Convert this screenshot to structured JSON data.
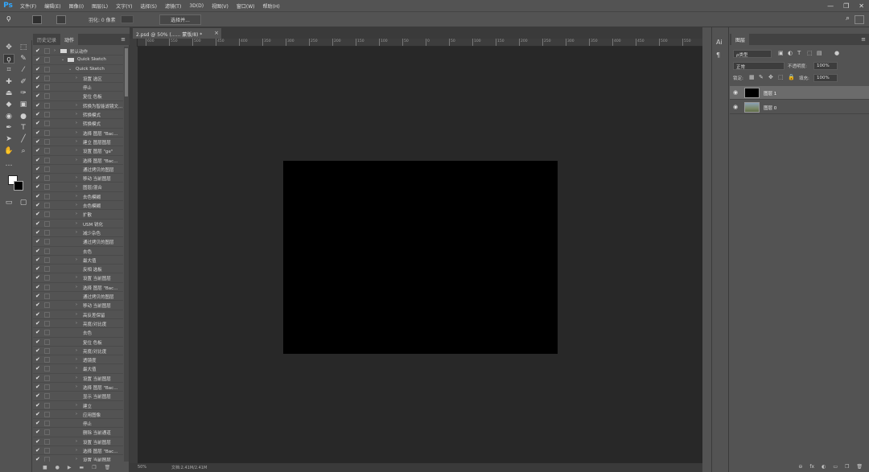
{
  "app": {
    "logo": "Ps"
  },
  "menu": [
    "文件(F)",
    "编辑(E)",
    "图像(I)",
    "图层(L)",
    "文字(Y)",
    "选择(S)",
    "滤镜(T)",
    "3D(D)",
    "视图(V)",
    "窗口(W)",
    "帮助(H)"
  ],
  "window_controls": [
    "—",
    "❐",
    "✕"
  ],
  "options": {
    "feather_label": "羽化: 0 像素",
    "select_mask_label": "选择并..."
  },
  "actions_panel": {
    "tabs": [
      "历史记录",
      "动作"
    ],
    "rows": [
      {
        "label": "默认动作",
        "indent": 0,
        "folder": true,
        "expand": "›"
      },
      {
        "label": "Quick Sketch",
        "indent": 1,
        "folder": true,
        "expand": "⌄"
      },
      {
        "label": "Quick Sketch",
        "indent": 2,
        "folder": false,
        "expand": "⌄"
      },
      {
        "label": "设置 选区",
        "indent": 3,
        "expand": "›"
      },
      {
        "label": "停止",
        "indent": 3,
        "expand": ""
      },
      {
        "label": "复位 色板",
        "indent": 3,
        "expand": ""
      },
      {
        "label": "转换为智能滤镜文...",
        "indent": 3,
        "expand": "›"
      },
      {
        "label": "转换模式",
        "indent": 3,
        "expand": "›"
      },
      {
        "label": "转换模式",
        "indent": 3,
        "expand": "›"
      },
      {
        "label": "选择 图层 \"Bac...",
        "indent": 3,
        "expand": "›"
      },
      {
        "label": "建立 图层图层",
        "indent": 3,
        "expand": "›"
      },
      {
        "label": "设置 图层 \"ge\"",
        "indent": 3,
        "expand": "›"
      },
      {
        "label": "选择 图层 \"Bac...",
        "indent": 3,
        "expand": "›"
      },
      {
        "label": "通过拷贝的图层",
        "indent": 3,
        "expand": ""
      },
      {
        "label": "移动 当前图层",
        "indent": 3,
        "expand": "›"
      },
      {
        "label": "图层/混合",
        "indent": 3,
        "expand": "›"
      },
      {
        "label": "去色模糊",
        "indent": 3,
        "expand": "›"
      },
      {
        "label": "去色模糊",
        "indent": 3,
        "expand": "›"
      },
      {
        "label": "扩散",
        "indent": 3,
        "expand": "›"
      },
      {
        "label": "USM 锐化",
        "indent": 3,
        "expand": "›"
      },
      {
        "label": "减少杂色",
        "indent": 3,
        "expand": "›"
      },
      {
        "label": "通过拷贝的图层",
        "indent": 3,
        "expand": ""
      },
      {
        "label": "去色",
        "indent": 3,
        "expand": ""
      },
      {
        "label": "最大值",
        "indent": 3,
        "expand": "›"
      },
      {
        "label": "反相 选板",
        "indent": 3,
        "expand": ""
      },
      {
        "label": "设置 当前图层",
        "indent": 3,
        "expand": "›"
      },
      {
        "label": "选择 图层 \"Bac...",
        "indent": 3,
        "expand": "›"
      },
      {
        "label": "通过拷贝的图层",
        "indent": 3,
        "expand": ""
      },
      {
        "label": "移动 当前图层",
        "indent": 3,
        "expand": "›"
      },
      {
        "label": "高反差保留",
        "indent": 3,
        "expand": "›"
      },
      {
        "label": "亮度/对比度",
        "indent": 3,
        "expand": "›"
      },
      {
        "label": "去色",
        "indent": 3,
        "expand": ""
      },
      {
        "label": "复位 色板",
        "indent": 3,
        "expand": ""
      },
      {
        "label": "亮度/对比度",
        "indent": 3,
        "expand": "›"
      },
      {
        "label": "透镜度",
        "indent": 3,
        "expand": "›"
      },
      {
        "label": "最大值",
        "indent": 3,
        "expand": "›"
      },
      {
        "label": "设置 当前图层",
        "indent": 3,
        "expand": "›"
      },
      {
        "label": "选择 图层 \"Bac...",
        "indent": 3,
        "expand": "›"
      },
      {
        "label": "显示 当前图层",
        "indent": 3,
        "expand": ""
      },
      {
        "label": "建立",
        "indent": 3,
        "expand": "›"
      },
      {
        "label": "应用图像",
        "indent": 3,
        "expand": "›"
      },
      {
        "label": "停止",
        "indent": 3,
        "expand": ""
      },
      {
        "label": "删除 当前通道",
        "indent": 3,
        "expand": ""
      },
      {
        "label": "设置 当前图层",
        "indent": 3,
        "expand": "›"
      },
      {
        "label": "选择 图层 \"Bac...",
        "indent": 3,
        "expand": "›"
      },
      {
        "label": "设置 当前图层",
        "indent": 3,
        "expand": "›"
      }
    ],
    "footer_icons": [
      "■",
      "●",
      "▶",
      "▬",
      "❐",
      "🗑"
    ]
  },
  "document": {
    "tab_label": "2.psd @ 50% (...... 蒙版/8) *",
    "close_glyph": "×",
    "ruler_labels": [
      "600",
      "550",
      "500",
      "450",
      "400",
      "350",
      "300",
      "250",
      "200",
      "150",
      "100",
      "50",
      "0",
      "50",
      "100",
      "150",
      "200",
      "250",
      "300",
      "350",
      "400",
      "450",
      "500",
      "550",
      "600",
      "650",
      "700",
      "750",
      "800",
      "850",
      "900",
      "950",
      "1000",
      "1050",
      "1100",
      "1150",
      "1200",
      "1250",
      "1300",
      "1350",
      "1400",
      "1450",
      "1500",
      "1550",
      "1600",
      "1650",
      "1700",
      "1750",
      "1800",
      "1850",
      "1900",
      "1950"
    ],
    "zoom": "50%",
    "status": "文档:2.41M/2.41M"
  },
  "layers_panel": {
    "tab": "图层",
    "filter_label": "ρ类型",
    "blend_mode": "正常",
    "opacity_label": "不透明度:",
    "opacity_value": "100%",
    "lock_label": "锁定:",
    "fill_label": "填充:",
    "fill_value": "100%",
    "layers": [
      {
        "name": "图层 1",
        "selected": true,
        "thumb_color": "#000000"
      },
      {
        "name": "图层 0",
        "selected": false,
        "thumb_color": "#7c8a6a"
      }
    ],
    "footer_icons": [
      "⊖",
      "fx",
      "◐",
      "▭",
      "❐",
      "🗑"
    ]
  }
}
